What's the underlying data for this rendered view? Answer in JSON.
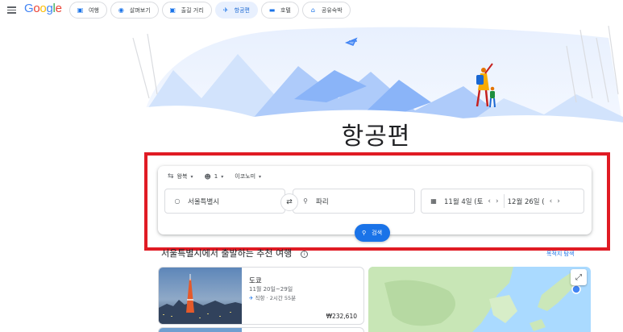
{
  "header": {
    "logo": [
      {
        "ch": "G",
        "color": "#4285f4"
      },
      {
        "ch": "o",
        "color": "#ea4335"
      },
      {
        "ch": "o",
        "color": "#fbbc05"
      },
      {
        "ch": "g",
        "color": "#4285f4"
      },
      {
        "ch": "l",
        "color": "#34a853"
      },
      {
        "ch": "e",
        "color": "#ea4335"
      }
    ],
    "chips": [
      {
        "label": "여행",
        "icon": "suitcase-icon",
        "active": false
      },
      {
        "label": "살펴보기",
        "icon": "explore-icon",
        "active": false
      },
      {
        "label": "출길 거리",
        "icon": "camera-icon",
        "active": false
      },
      {
        "label": "항공편",
        "icon": "airplane-icon",
        "active": true
      },
      {
        "label": "호텔",
        "icon": "bed-icon",
        "active": false
      },
      {
        "label": "공유숙박",
        "icon": "home-icon",
        "active": false
      }
    ]
  },
  "hero": {
    "title": "항공편"
  },
  "search": {
    "trip_type": "왕복",
    "passengers": "1",
    "cabin": "이코노미",
    "origin": "서울특별시",
    "destination": "파리",
    "depart_date": "11월 4일 (토",
    "return_date": "12월 26일 (",
    "search_label": "검색"
  },
  "section": {
    "title": "서울특별시에서 출발하는 추천 여행",
    "explore_link": "목적지 탐색"
  },
  "trips": [
    {
      "city": "도쿄",
      "dates": "11월 20일~29일",
      "info": "직항 · 2시간 55분",
      "price": "₩232,610"
    }
  ],
  "colors": {
    "accent": "#1a73e8",
    "highlight": "#e01b24",
    "hero_sky": "#e8f0fe"
  }
}
